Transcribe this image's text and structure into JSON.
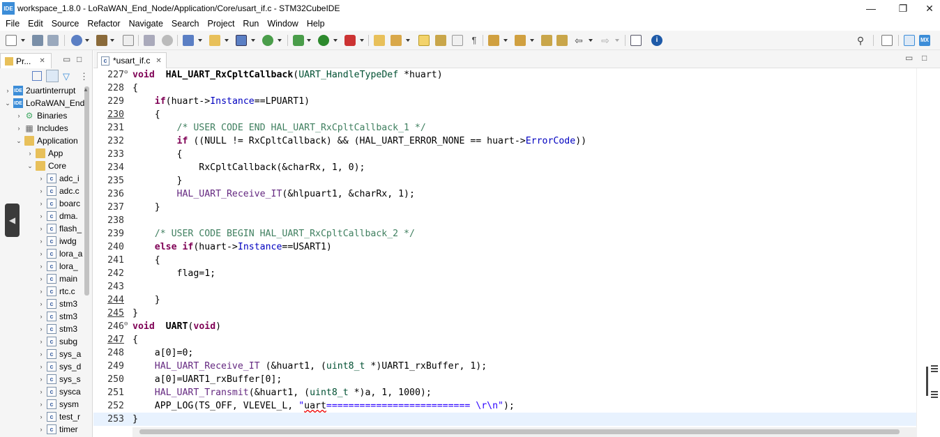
{
  "window": {
    "title": "workspace_1.8.0 - LoRaWAN_End_Node/Application/Core/usart_if.c - STM32CubeIDE",
    "logo_text": "IDE",
    "minimize_glyph": "—",
    "maximize_glyph": "❐",
    "close_glyph": "✕"
  },
  "menu": [
    "File",
    "Edit",
    "Source",
    "Refactor",
    "Navigate",
    "Search",
    "Project",
    "Run",
    "Window",
    "Help"
  ],
  "left_panel": {
    "tab_label": "Pr...",
    "tree": [
      {
        "depth": 0,
        "twisty": "›",
        "icon": "project",
        "label": "2uartinterrupt"
      },
      {
        "depth": 0,
        "twisty": "⌄",
        "icon": "project",
        "label": "LoRaWAN_End"
      },
      {
        "depth": 1,
        "twisty": "›",
        "icon": "binaries",
        "label": "Binaries"
      },
      {
        "depth": 1,
        "twisty": "›",
        "icon": "includes",
        "label": "Includes"
      },
      {
        "depth": 1,
        "twisty": "⌄",
        "icon": "folder",
        "label": "Application"
      },
      {
        "depth": 2,
        "twisty": "›",
        "icon": "folder",
        "label": "App"
      },
      {
        "depth": 2,
        "twisty": "⌄",
        "icon": "folder",
        "label": "Core"
      },
      {
        "depth": 3,
        "twisty": "›",
        "icon": "file",
        "label": "adc_i"
      },
      {
        "depth": 3,
        "twisty": "›",
        "icon": "file",
        "label": "adc.c"
      },
      {
        "depth": 3,
        "twisty": "›",
        "icon": "file",
        "label": "boarc"
      },
      {
        "depth": 3,
        "twisty": "›",
        "icon": "file",
        "label": "dma."
      },
      {
        "depth": 3,
        "twisty": "›",
        "icon": "file",
        "label": "flash_"
      },
      {
        "depth": 3,
        "twisty": "›",
        "icon": "file",
        "label": "iwdg"
      },
      {
        "depth": 3,
        "twisty": "›",
        "icon": "file",
        "label": "lora_a"
      },
      {
        "depth": 3,
        "twisty": "›",
        "icon": "file",
        "label": "lora_"
      },
      {
        "depth": 3,
        "twisty": "›",
        "icon": "file",
        "label": "main"
      },
      {
        "depth": 3,
        "twisty": "›",
        "icon": "file",
        "label": "rtc.c"
      },
      {
        "depth": 3,
        "twisty": "›",
        "icon": "file",
        "label": "stm3"
      },
      {
        "depth": 3,
        "twisty": "›",
        "icon": "file",
        "label": "stm3"
      },
      {
        "depth": 3,
        "twisty": "›",
        "icon": "file",
        "label": "stm3"
      },
      {
        "depth": 3,
        "twisty": "›",
        "icon": "file",
        "label": "subg"
      },
      {
        "depth": 3,
        "twisty": "›",
        "icon": "file",
        "label": "sys_a"
      },
      {
        "depth": 3,
        "twisty": "›",
        "icon": "file",
        "label": "sys_d"
      },
      {
        "depth": 3,
        "twisty": "›",
        "icon": "file",
        "label": "sys_s"
      },
      {
        "depth": 3,
        "twisty": "›",
        "icon": "file",
        "label": "sysca"
      },
      {
        "depth": 3,
        "twisty": "›",
        "icon": "file",
        "label": "sysm"
      },
      {
        "depth": 3,
        "twisty": "›",
        "icon": "file",
        "label": "test_r"
      },
      {
        "depth": 3,
        "twisty": "›",
        "icon": "file",
        "label": "timer"
      }
    ]
  },
  "editor": {
    "tab_label": "*usart_if.c",
    "tab_close": "✕",
    "current_line": 253,
    "lines": [
      {
        "n": "227",
        "fold": true,
        "u": false,
        "tokens": [
          [
            "kw",
            "void"
          ],
          [
            "",
            "  "
          ],
          [
            "fn",
            "HAL_UART_RxCpltCallback"
          ],
          [
            "",
            "("
          ],
          [
            "ty",
            "UART_HandleTypeDef"
          ],
          [
            "",
            " *huart)"
          ]
        ]
      },
      {
        "n": "228",
        "u": false,
        "tokens": [
          [
            "",
            "{"
          ]
        ]
      },
      {
        "n": "229",
        "u": false,
        "tokens": [
          [
            "",
            "    "
          ],
          [
            "kw",
            "if"
          ],
          [
            "",
            "(huart->"
          ],
          [
            "fd",
            "Instance"
          ],
          [
            "",
            "==LPUART1)"
          ]
        ]
      },
      {
        "n": "230",
        "u": true,
        "tokens": [
          [
            "",
            "    {"
          ]
        ]
      },
      {
        "n": "231",
        "u": false,
        "tokens": [
          [
            "",
            "        "
          ],
          [
            "cm",
            "/* USER CODE END HAL_UART_RxCpltCallback_1 */"
          ]
        ]
      },
      {
        "n": "232",
        "u": false,
        "tokens": [
          [
            "",
            "        "
          ],
          [
            "kw",
            "if"
          ],
          [
            "",
            " ((NULL != RxCpltCallback) && (HAL_UART_ERROR_NONE == huart->"
          ],
          [
            "fd",
            "ErrorCode"
          ],
          [
            "",
            "))"
          ]
        ]
      },
      {
        "n": "233",
        "u": false,
        "tokens": [
          [
            "",
            "        {"
          ]
        ]
      },
      {
        "n": "234",
        "u": false,
        "tokens": [
          [
            "",
            "            RxCpltCallback(&charRx, 1, 0);"
          ]
        ]
      },
      {
        "n": "235",
        "u": false,
        "tokens": [
          [
            "",
            "        }"
          ]
        ]
      },
      {
        "n": "236",
        "u": false,
        "tokens": [
          [
            "",
            "        "
          ],
          [
            "mac",
            "HAL_UART_Receive_IT"
          ],
          [
            "",
            "(&hlpuart1, &charRx, 1);"
          ]
        ]
      },
      {
        "n": "237",
        "u": false,
        "tokens": [
          [
            "",
            "    }"
          ]
        ]
      },
      {
        "n": "238",
        "u": false,
        "tokens": [
          [
            "",
            ""
          ]
        ]
      },
      {
        "n": "239",
        "u": false,
        "tokens": [
          [
            "",
            "    "
          ],
          [
            "cm",
            "/* USER CODE BEGIN HAL_UART_RxCpltCallback_2 */"
          ]
        ]
      },
      {
        "n": "240",
        "u": false,
        "tokens": [
          [
            "",
            "    "
          ],
          [
            "kw",
            "else if"
          ],
          [
            "",
            "(huart->"
          ],
          [
            "fd",
            "Instance"
          ],
          [
            "",
            "==USART1)"
          ]
        ]
      },
      {
        "n": "241",
        "u": false,
        "tokens": [
          [
            "",
            "    {"
          ]
        ]
      },
      {
        "n": "242",
        "u": false,
        "tokens": [
          [
            "",
            "        flag=1;"
          ]
        ]
      },
      {
        "n": "243",
        "u": false,
        "tokens": [
          [
            "",
            ""
          ]
        ]
      },
      {
        "n": "244",
        "u": true,
        "tokens": [
          [
            "",
            "    }"
          ]
        ]
      },
      {
        "n": "245",
        "u": true,
        "tokens": [
          [
            "",
            "}"
          ]
        ]
      },
      {
        "n": "246",
        "fold": true,
        "u": false,
        "tokens": [
          [
            "kw",
            "void"
          ],
          [
            "",
            "  "
          ],
          [
            "fn",
            "UART"
          ],
          [
            "",
            "("
          ],
          [
            "kw",
            "void"
          ],
          [
            "",
            ")"
          ]
        ]
      },
      {
        "n": "247",
        "u": true,
        "tokens": [
          [
            "",
            "{"
          ]
        ]
      },
      {
        "n": "248",
        "u": false,
        "tokens": [
          [
            "",
            "    a[0]=0;"
          ]
        ]
      },
      {
        "n": "249",
        "u": false,
        "tokens": [
          [
            "",
            "    "
          ],
          [
            "mac",
            "HAL_UART_Receive_IT"
          ],
          [
            "",
            " (&huart1, ("
          ],
          [
            "ty",
            "uint8_t"
          ],
          [
            "",
            " *)UART1_rxBuffer, 1);"
          ]
        ]
      },
      {
        "n": "250",
        "u": false,
        "tokens": [
          [
            "",
            "    a[0]=UART1_rxBuffer[0];"
          ]
        ]
      },
      {
        "n": "251",
        "u": false,
        "tokens": [
          [
            "",
            "    "
          ],
          [
            "mac",
            "HAL_UART_Transmit"
          ],
          [
            "",
            "(&huart1, ("
          ],
          [
            "ty",
            "uint8_t"
          ],
          [
            "",
            " *)a, 1, 1000);"
          ]
        ]
      },
      {
        "n": "252",
        "u": false,
        "tokens": [
          [
            "",
            "    APP_LOG(TS_OFF, VLEVEL_L, "
          ],
          [
            "st",
            "\""
          ],
          [
            "sq",
            "uart"
          ],
          [
            "st",
            "========================== \\r\\n\""
          ],
          [
            "",
            ");"
          ]
        ]
      },
      {
        "n": "253",
        "u": false,
        "tokens": [
          [
            "",
            "}"
          ]
        ]
      }
    ]
  },
  "colors": {
    "keyword": "#7f0055",
    "comment": "#3f7f5f",
    "field": "#0000c0",
    "string": "#2a00ff",
    "macro": "#642880",
    "type": "#005032",
    "current_line": "#e8f2fe",
    "brand": "#3c8dd8"
  }
}
